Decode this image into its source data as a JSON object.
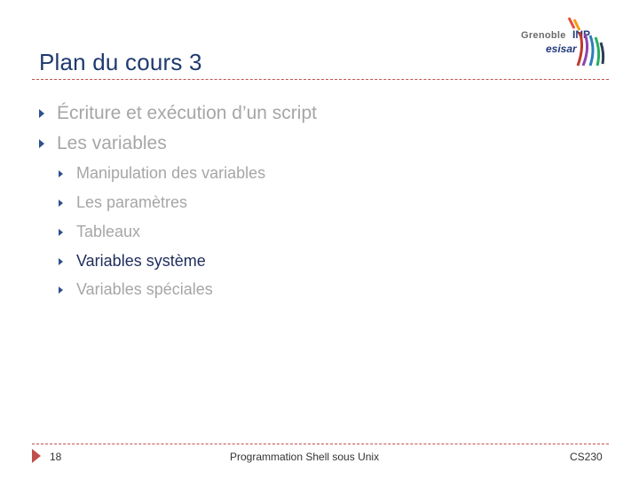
{
  "slide": {
    "title": "Plan du cours 3",
    "logo": {
      "line1": "Grenoble",
      "line1b": "INP",
      "line2": "esisar",
      "accent_color": "#c0504d",
      "brand_color": "#1f3a7a"
    },
    "outline": [
      {
        "label": "Écriture et exécution d’un script",
        "level": 1,
        "active": false
      },
      {
        "label": "Les variables",
        "level": 1,
        "active": false
      },
      {
        "label": "Manipulation des variables",
        "level": 2,
        "active": false
      },
      {
        "label": "Les paramètres",
        "level": 2,
        "active": false
      },
      {
        "label": "Tableaux",
        "level": 2,
        "active": false
      },
      {
        "label": "Variables système",
        "level": 2,
        "active": true
      },
      {
        "label": "Variables spéciales",
        "level": 2,
        "active": false
      }
    ],
    "footer": {
      "page_number": "18",
      "course_title": "Programmation Shell sous Unix",
      "course_code": "CS230"
    }
  }
}
